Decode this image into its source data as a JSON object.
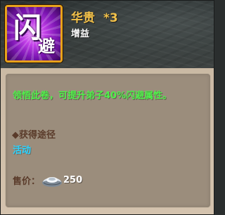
{
  "item": {
    "icon_glyph_main": "闪",
    "icon_glyph_sub": "避",
    "name": "华贵",
    "count": "*3",
    "type": "增益"
  },
  "description": "领悟此卷，可提升弟子40%闪避属性。",
  "source": {
    "title": "◆获得途径",
    "value": "活动"
  },
  "price": {
    "label": "售价：",
    "value": "250",
    "currency_icon": "silver-ingot-icon"
  },
  "colors": {
    "name": "#f3c24a",
    "description": "#4ff04a",
    "source_value": "#2bd3ff",
    "label": "#5a3b2a",
    "icon_border": "#e6a21b"
  }
}
